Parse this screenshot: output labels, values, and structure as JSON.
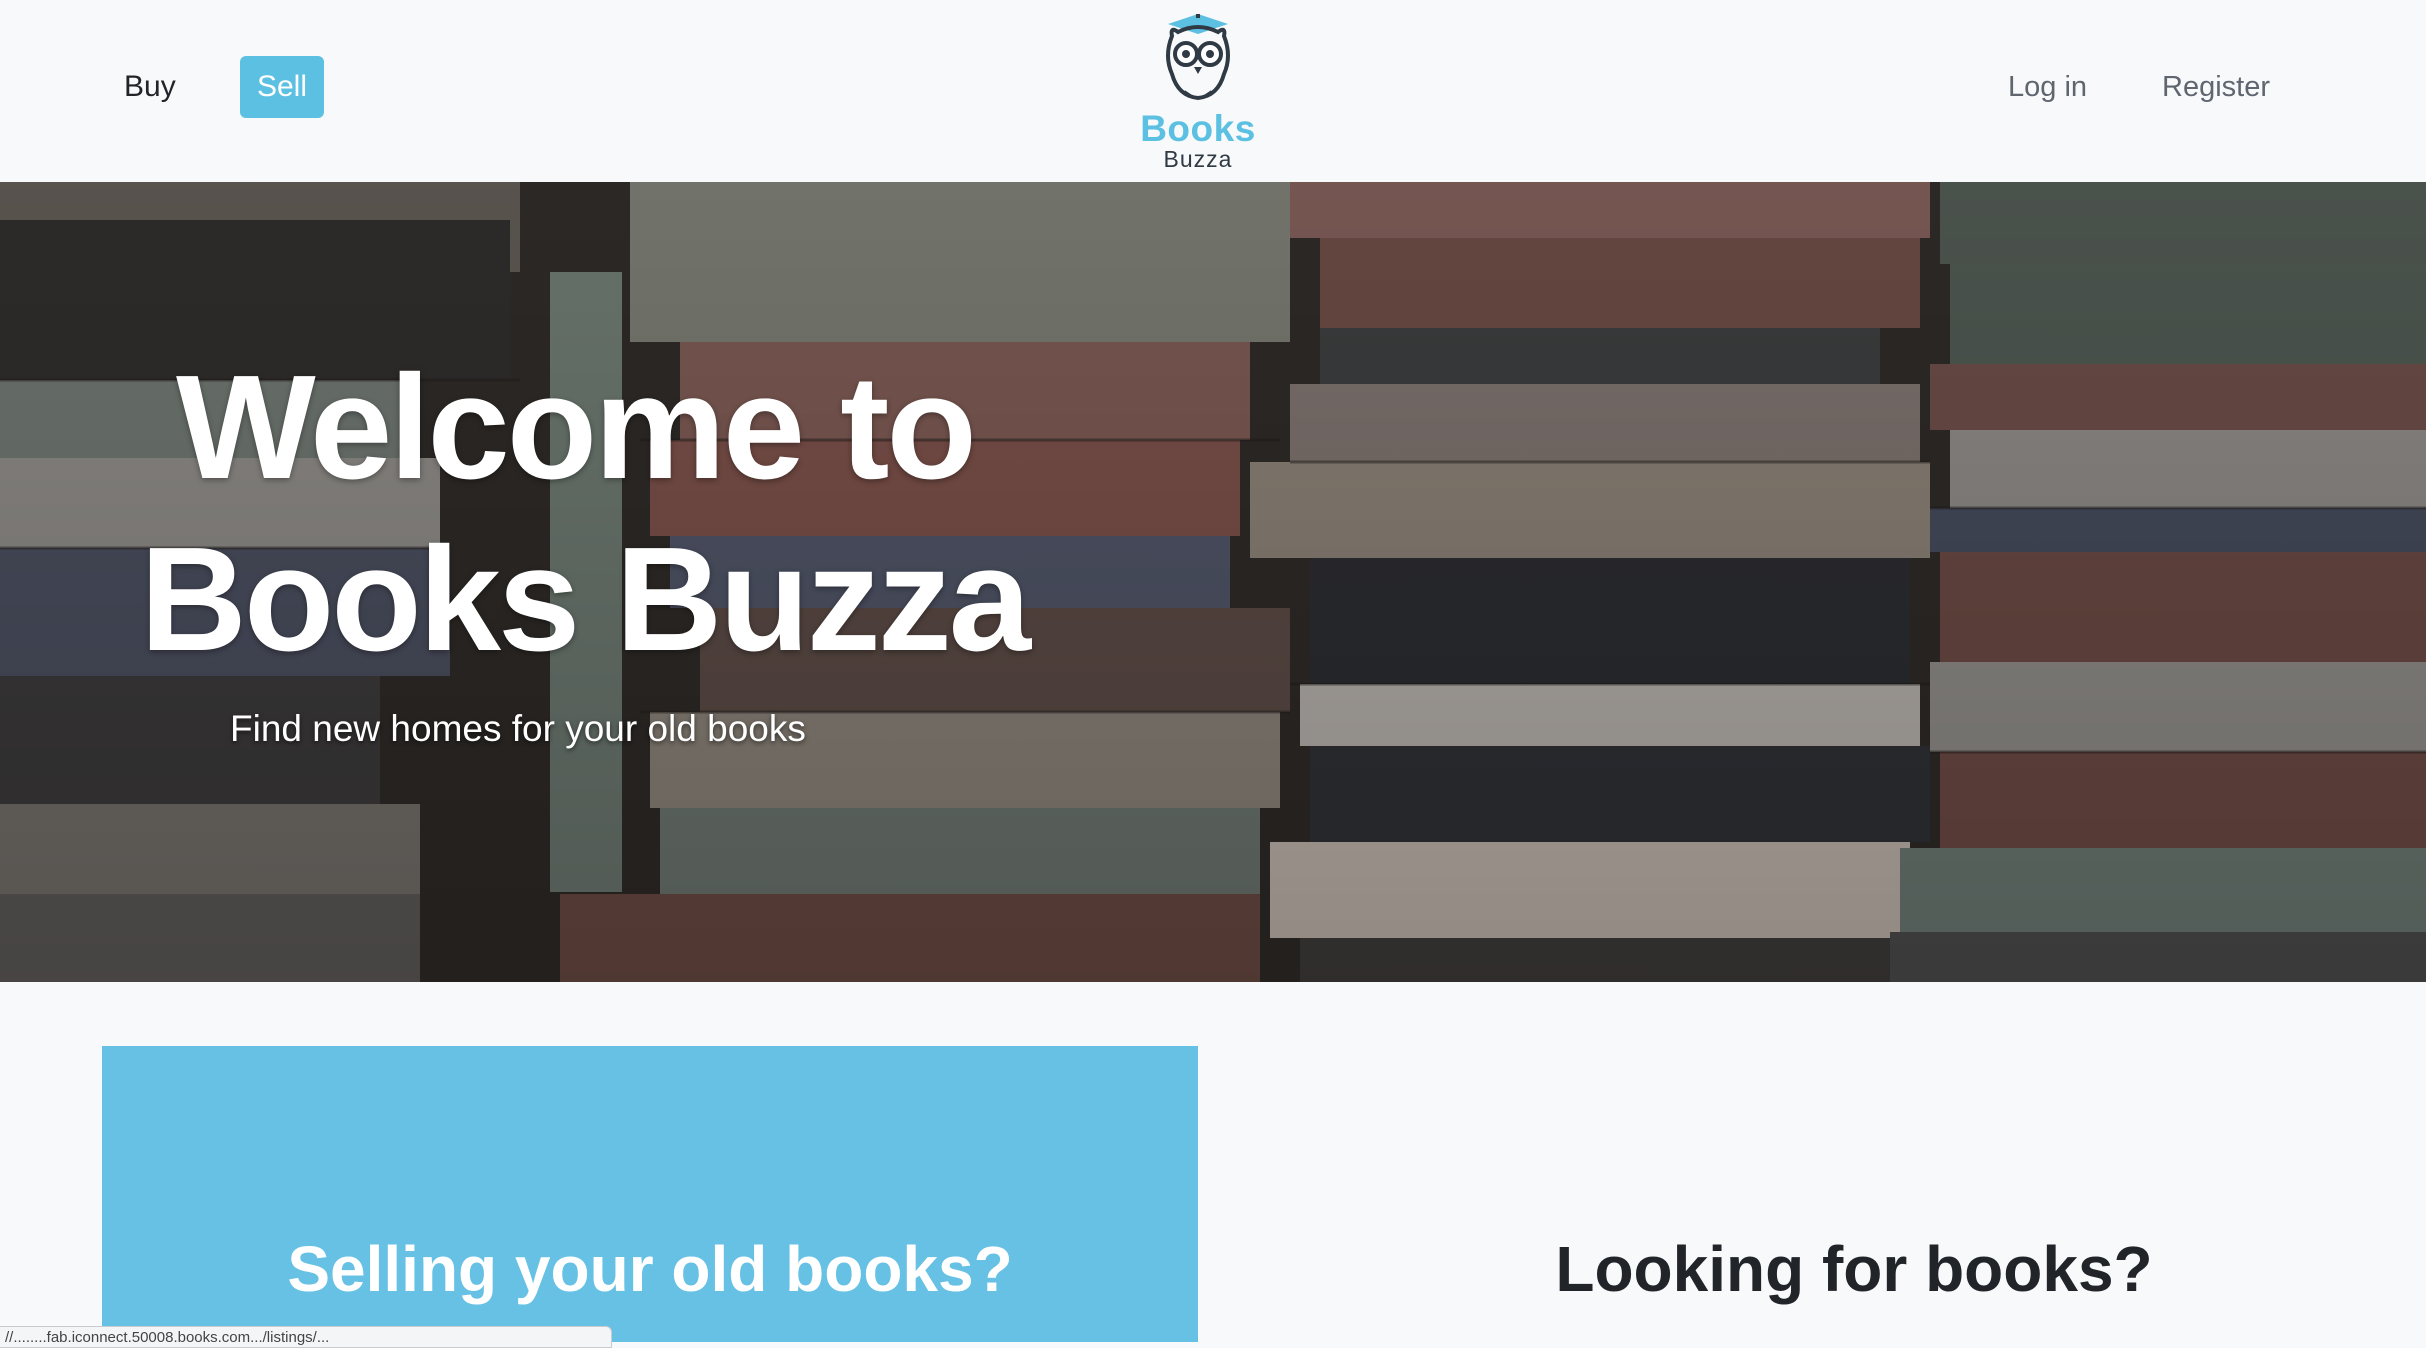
{
  "navbar": {
    "buy_label": "Buy",
    "sell_label": "Sell",
    "login_label": "Log in",
    "register_label": "Register",
    "logo_title": "Books",
    "logo_subtitle": "Buzza",
    "accent_color": "#5bc0e2"
  },
  "hero": {
    "title_line1": "Welcome to",
    "title_line2": "Books Buzza",
    "subtitle": "Find new homes for your old books"
  },
  "sell_card": {
    "title": "Selling your old books?",
    "background_color": "#66c1e4"
  },
  "buy_card": {
    "title": "Looking for books?"
  },
  "status_bar": {
    "url": "//........fab.iconnect.50008.books.com.../listings/..."
  }
}
